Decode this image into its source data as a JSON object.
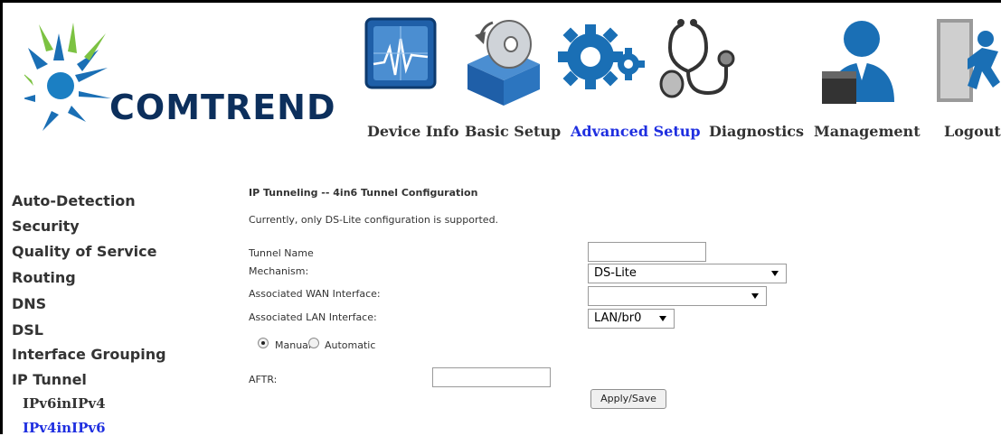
{
  "brand": {
    "name": "COMTREND"
  },
  "nav": {
    "items": [
      {
        "label": "Device Info",
        "icon": "device-info-icon"
      },
      {
        "label": "Basic Setup",
        "icon": "basic-setup-icon"
      },
      {
        "label": "Advanced Setup",
        "icon": "advanced-setup-icon",
        "active": true
      },
      {
        "label": "Diagnostics",
        "icon": "diagnostics-icon"
      },
      {
        "label": "Management",
        "icon": "management-icon"
      },
      {
        "label": "Logout",
        "icon": "logout-icon"
      }
    ]
  },
  "sidebar": {
    "items": [
      {
        "label": "Auto-Detection"
      },
      {
        "label": "Security"
      },
      {
        "label": "Quality of Service"
      },
      {
        "label": "Routing"
      },
      {
        "label": "DNS"
      },
      {
        "label": "DSL"
      },
      {
        "label": "Interface Grouping"
      },
      {
        "label": "IP Tunnel"
      },
      {
        "label": "IPv6inIPv4"
      },
      {
        "label": "IPv4inIPv6",
        "active": true
      }
    ]
  },
  "form": {
    "title": "IP Tunneling -- 4in6 Tunnel Configuration",
    "note": "Currently, only DS-Lite configuration is supported.",
    "tunnel_name": {
      "label": "Tunnel Name",
      "value": ""
    },
    "mechanism": {
      "label": "Mechanism:",
      "value": "DS-Lite"
    },
    "wan_interface": {
      "label": "Associated WAN Interface:",
      "value": ""
    },
    "lan_interface": {
      "label": "Associated LAN Interface:",
      "value": "LAN/br0"
    },
    "mode": {
      "manual_label": "Manual",
      "automatic_label": "Automatic",
      "selected": "Manual"
    },
    "aftr": {
      "label": "AFTR:",
      "value": ""
    },
    "apply_label": "Apply/Save"
  },
  "colors": {
    "active_link": "#1f2fe0",
    "brand_navy": "#0c2f5c",
    "icon_blue": "#1a6fb5"
  }
}
